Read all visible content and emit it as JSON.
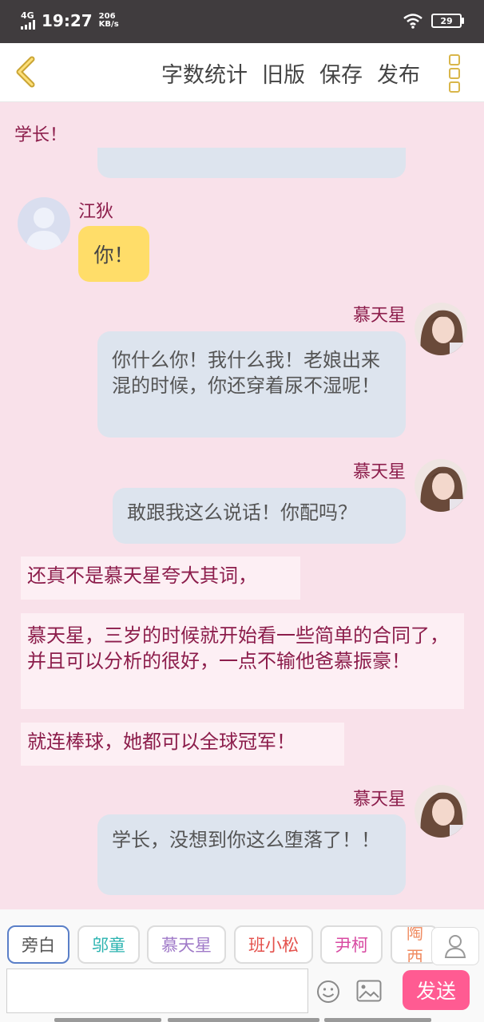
{
  "status_bar": {
    "network": "4G",
    "time": "19:27",
    "speed_value": "206",
    "speed_unit": "KB/s",
    "battery": "29"
  },
  "toolbar": {
    "word_count": "字数统计",
    "old_version": "旧版",
    "save": "保存",
    "publish": "发布"
  },
  "chat": {
    "narration_top": "学长！",
    "msg1": {
      "name": "江狄",
      "text": "你！"
    },
    "msg2": {
      "name": "慕天星",
      "text": "你什么你！我什么我！老娘出来混的时候，你还穿着尿不湿呢！"
    },
    "msg3": {
      "name": "慕天星",
      "text": "敢跟我这么说话！你配吗？"
    },
    "narration1": "还真不是慕天星夸大其词，",
    "narration2": "慕天星，三岁的时候就开始看一些简单的合同了，并且可以分析的很好，一点不输他爸慕振豪！",
    "narration3": "就连棒球，她都可以全球冠军！",
    "msg4": {
      "name": "慕天星",
      "text": "学长，没想到你这么堕落了！！"
    }
  },
  "characters": [
    {
      "label": "旁白",
      "color": "#555555"
    },
    {
      "label": "邬童",
      "color": "#2bb3b0"
    },
    {
      "label": "慕天星",
      "color": "#a07ac8"
    },
    {
      "label": "班小松",
      "color": "#e4514c"
    },
    {
      "label": "尹柯",
      "color": "#d84aa2"
    },
    {
      "label": "陶西",
      "color": "#f08c62"
    }
  ],
  "composer": {
    "send": "发送",
    "input_value": ""
  },
  "icons": {
    "back": "chevron-left-icon",
    "more": "more-vertical-icon",
    "profile": "user-icon",
    "emoji": "smile-icon",
    "image": "image-icon"
  },
  "colors": {
    "accent": "#ff5b92",
    "background": "#f9e1ea",
    "bubble": "#dde4ee",
    "yellow_bubble": "#ffdd69",
    "name": "#8c1d4b"
  }
}
